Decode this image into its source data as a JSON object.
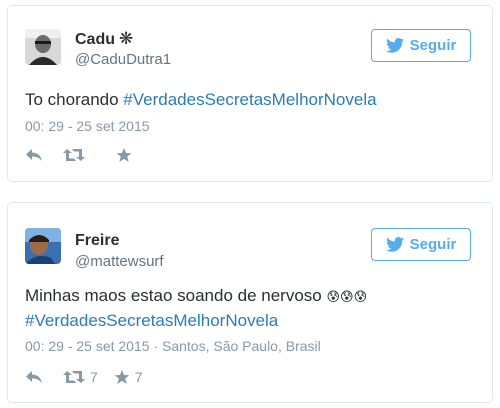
{
  "tweets": [
    {
      "name": "Cadu",
      "name_badge": "❋",
      "handle": "@CaduDutra1",
      "follow_label": "Seguir",
      "text_prefix": "To chorando ",
      "hashtag": "#VerdadesSecretasMelhorNovela",
      "timestamp": "00: 29 - 25 set 2015",
      "location": "",
      "retweets": "",
      "favorites": ""
    },
    {
      "name": "Freire",
      "handle": "@mattewsurf",
      "follow_label": "Seguir",
      "text_prefix": "Minhas maos estao soando de nervoso ",
      "emojis": "😰😰😰",
      "hashtag": "#VerdadesSecretasMelhorNovela",
      "timestamp": "00: 29 - 25 set 2015",
      "location_separator": " · ",
      "location": "Santos, São Paulo, Brasil",
      "retweets": "7",
      "favorites": "7"
    }
  ],
  "colors": {
    "accent": "#55acee",
    "hashtag": "#2b7bb9",
    "muted": "#8899a6",
    "border": "#e1e8ed"
  }
}
